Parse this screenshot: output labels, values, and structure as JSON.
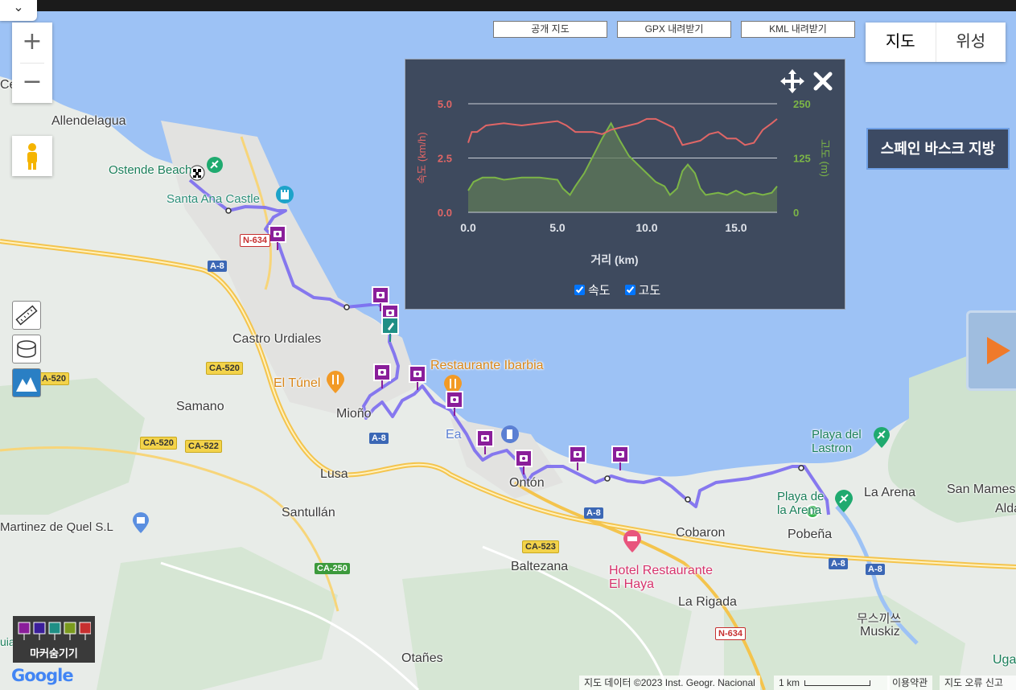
{
  "top_buttons": {
    "public_map": "공개 지도",
    "gpx": "GPX 내려받기",
    "kml": "KML 내려받기"
  },
  "map_type": {
    "map": "지도",
    "satellite": "위성"
  },
  "zoom": {
    "in": "+",
    "out": "−"
  },
  "region_button": "스페인 바스크 지방",
  "chart_panel": {
    "legend": {
      "speed": "속도",
      "elevation": "고도"
    },
    "icons": [
      "move-icon",
      "close-icon"
    ]
  },
  "chart_data": {
    "type": "area",
    "xlabel": "거리 (km)",
    "ylabel_left": "속도 (km/h)",
    "ylabel_right": "고도 (m)",
    "x_ticks": [
      "0.0",
      "5.0",
      "10.0",
      "15.0"
    ],
    "y_left_ticks": [
      "0.0",
      "2.5",
      "5.0"
    ],
    "y_right_ticks": [
      "0",
      "125",
      "250"
    ],
    "xlim": [
      0,
      17.3
    ],
    "ylim_left": [
      0,
      5.0
    ],
    "ylim_right": [
      0,
      250
    ],
    "series": [
      {
        "name": "속도",
        "axis": "left",
        "color": "#e06666",
        "x": [
          0,
          0.2,
          0.5,
          1,
          2,
          3,
          4,
          5,
          5.5,
          6,
          6.5,
          7,
          7.5,
          8,
          8.5,
          9,
          9.5,
          10,
          10.5,
          11,
          11.5,
          12,
          12.5,
          13,
          13.5,
          14,
          14.5,
          15,
          15.5,
          16,
          16.5,
          17,
          17.3
        ],
        "y": [
          3.2,
          3.7,
          3.7,
          4.0,
          4.1,
          4.0,
          4.1,
          4.2,
          4.0,
          3.7,
          3.7,
          3.7,
          3.6,
          3.8,
          3.9,
          4.0,
          4.1,
          4.3,
          4.3,
          4.1,
          3.9,
          3.1,
          3.2,
          3.3,
          3.6,
          3.7,
          3.4,
          3.4,
          3.1,
          3.2,
          3.8,
          4.1,
          4.3
        ]
      },
      {
        "name": "고도",
        "axis": "right",
        "color": "#7cb547",
        "x": [
          0,
          0.3,
          0.8,
          1.5,
          2,
          3,
          4,
          5,
          5.3,
          5.7,
          6,
          6.5,
          7,
          7.5,
          8,
          8.5,
          9,
          9.5,
          10,
          10.5,
          11,
          11.3,
          11.7,
          12,
          12.3,
          12.7,
          13,
          13.3,
          14,
          14.5,
          15,
          15.5,
          16,
          16.5,
          17,
          17.3
        ],
        "y": [
          50,
          70,
          80,
          80,
          75,
          80,
          80,
          75,
          55,
          40,
          60,
          90,
          130,
          170,
          205,
          165,
          130,
          110,
          90,
          70,
          60,
          40,
          55,
          95,
          110,
          90,
          55,
          40,
          45,
          40,
          50,
          40,
          45,
          40,
          45,
          60
        ]
      }
    ]
  },
  "map_labels": {
    "allendelagua": "Allendelagua",
    "ostende": "Ostende Beach",
    "santa_ana": "Santa Ana Castle",
    "castro": "Castro Urdiales",
    "el_tunel": "El Túnel",
    "ibarbia": "Restaurante Ibarbia",
    "samano": "Samano",
    "mioño": "Mioño",
    "lusa": "Lusa",
    "santullan": "Santullán",
    "martinez": "Martinez de Quel S.L",
    "ontón": "Ontón",
    "baltezana": "Baltezana",
    "hotel": "Hotel Restaurante\nEl Haya",
    "la_rigada": "La Rigada",
    "cobaron": "Cobaron",
    "pobena": "Pobeña",
    "playa_arena": "Playa de\nla Arena",
    "playa_lastron": "Playa del\nLastron",
    "la_arena": "La Arena",
    "san_mames": "San Mames",
    "alda": "Alda",
    "muskiz_kr": "무스끼쓰",
    "muskiz": "Muskiz",
    "otanes": "Otañes",
    "eas": "Ea",
    "cel": "Cel",
    "uia": "uia",
    "uga": "Uga"
  },
  "road_signs": [
    "A-8",
    "N-634",
    "A-8",
    "CA-520",
    "A-520",
    "CA-520",
    "CA-522",
    "A-8",
    "CA-250",
    "A-8",
    "CA-523",
    "A-8",
    "A-8",
    "N-634"
  ],
  "markers_toggle": "마커숨기기",
  "footer": {
    "map_data": "지도 데이터 ©2023 Inst. Geogr. Nacional",
    "scale": "1 km",
    "terms": "이용약관",
    "report": "지도 오류 신고"
  },
  "google_logo": "Google",
  "colors": {
    "route": "#7b6cf0",
    "water": "#9dc2f5",
    "land": "#e8ece8",
    "speed": "#e06666",
    "elevation": "#7cb547",
    "marker": "#8a1e9a"
  }
}
